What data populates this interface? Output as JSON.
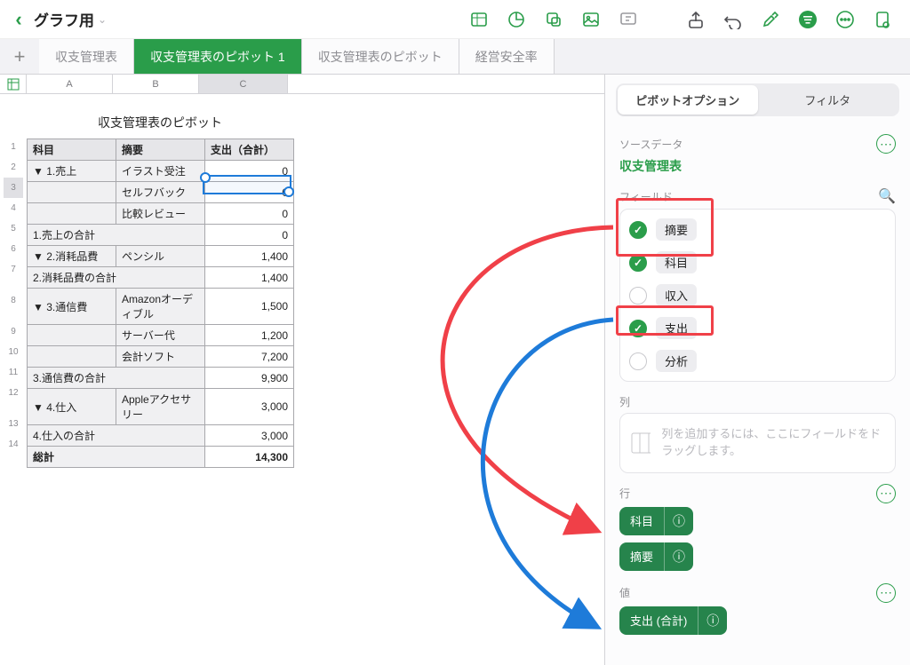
{
  "toolbar": {
    "doc_title": "グラフ用"
  },
  "tabs": {
    "items": [
      "収支管理表",
      "収支管理表のピボット 1",
      "収支管理表のピボット",
      "経営安全率"
    ],
    "active_index": 1
  },
  "columns": [
    "A",
    "B",
    "C"
  ],
  "pivot": {
    "title": "収支管理表のピボット",
    "headers": [
      "科目",
      "摘要",
      "支出（合計）"
    ],
    "rows": [
      {
        "n": "1",
        "kamoku": "▼ 1.売上",
        "tekiyo": "イラスト受注",
        "val": "0"
      },
      {
        "n": "2",
        "kamoku": "",
        "tekiyo": "セルフバック",
        "val": "0",
        "selected": true
      },
      {
        "n": "3",
        "kamoku": "",
        "tekiyo": "比較レビュー",
        "val": "0"
      },
      {
        "n": "4",
        "kamoku": "1.売上の合計",
        "tekiyo": "",
        "val": "0",
        "span": true
      },
      {
        "n": "5",
        "kamoku": "▼ 2.消耗品費",
        "tekiyo": "ペンシル",
        "val": "1,400"
      },
      {
        "n": "6",
        "kamoku": "2.消耗品費の合計",
        "tekiyo": "",
        "val": "1,400",
        "span": true
      },
      {
        "n": "7",
        "kamoku": "▼ 3.通信費",
        "tekiyo": "Amazonオーディブル",
        "val": "1,500"
      },
      {
        "n": "8",
        "kamoku": "",
        "tekiyo": "サーバー代",
        "val": "1,200"
      },
      {
        "n": "9",
        "kamoku": "",
        "tekiyo": "会計ソフト",
        "val": "7,200"
      },
      {
        "n": "10",
        "kamoku": "3.通信費の合計",
        "tekiyo": "",
        "val": "9,900",
        "span": true
      },
      {
        "n": "11",
        "kamoku": "▼ 4.仕入",
        "tekiyo": "Appleアクセサリー",
        "val": "3,000"
      },
      {
        "n": "12",
        "kamoku": "4.仕入の合計",
        "tekiyo": "",
        "val": "3,000",
        "span": true
      },
      {
        "n": "13",
        "kamoku": "総計",
        "tekiyo": "",
        "val": "14,300",
        "span": true,
        "grand": true
      }
    ],
    "row_numbers_left": [
      "1",
      "2",
      "3",
      "4",
      "5",
      "6",
      "7",
      "8",
      "9",
      "10",
      "11",
      "12",
      "13",
      "14"
    ],
    "selected_row_index": 2
  },
  "panel": {
    "seg": {
      "pivot_options": "ピボットオプション",
      "filter": "フィルタ"
    },
    "source_label": "ソースデータ",
    "source_name": "収支管理表",
    "fields_label": "フィールド",
    "fields": [
      {
        "label": "摘要",
        "checked": true
      },
      {
        "label": "科目",
        "checked": true
      },
      {
        "label": "収入",
        "checked": false
      },
      {
        "label": "支出",
        "checked": true
      },
      {
        "label": "分析",
        "checked": false
      }
    ],
    "columns_label": "列",
    "columns_hint": "列を追加するには、ここにフィールドをドラッグします。",
    "rows_label": "行",
    "row_pills": [
      "科目",
      "摘要"
    ],
    "values_label": "値",
    "value_pills": [
      "支出 (合計)"
    ]
  }
}
